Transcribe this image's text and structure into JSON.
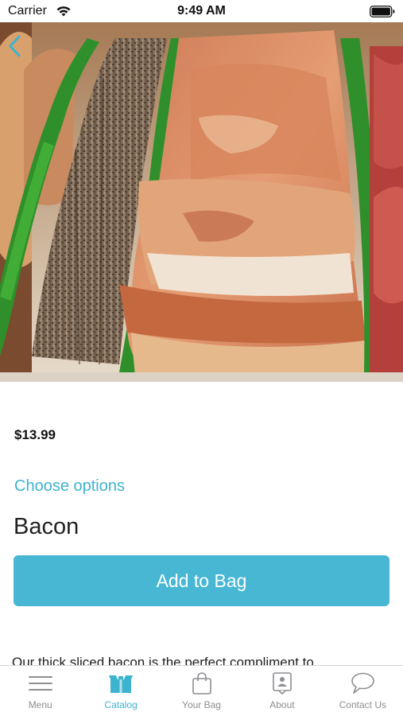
{
  "status_bar": {
    "carrier": "Carrier",
    "time": "9:49 AM"
  },
  "product": {
    "price": "$13.99",
    "choose_options": "Choose options",
    "title": "Bacon",
    "add_to_bag": "Add to Bag",
    "description": "Our thick sliced bacon is the perfect compliment to"
  },
  "tab_bar": {
    "items": [
      {
        "label": "Menu",
        "icon": "menu-icon"
      },
      {
        "label": "Catalog",
        "icon": "catalog-icon",
        "active": true
      },
      {
        "label": "Your Bag",
        "icon": "bag-icon"
      },
      {
        "label": "About",
        "icon": "about-icon"
      },
      {
        "label": "Contact Us",
        "icon": "chat-icon"
      }
    ]
  },
  "colors": {
    "accent": "#3eb3cf",
    "button": "#47b7d3",
    "tab_inactive": "#8e8e93"
  }
}
